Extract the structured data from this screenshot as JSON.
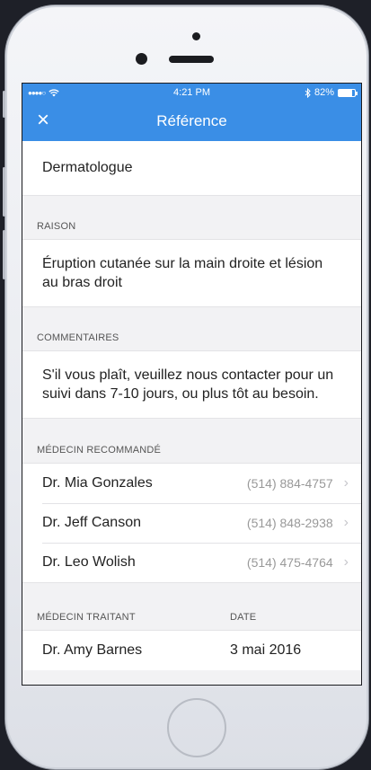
{
  "status": {
    "time": "4:21 PM",
    "battery": "82%",
    "battery_level": 0.82
  },
  "nav": {
    "title": "Référence",
    "close_icon": "close-icon"
  },
  "specialty": "Dermatologue",
  "reason": {
    "header": "RAISON",
    "text": "Éruption cutanée sur la main droite et lésion au bras droit"
  },
  "comments": {
    "header": "COMMENTAIRES",
    "text": "S'il vous plaît, veuillez nous contacter pour un suivi dans 7-10 jours, ou plus tôt au besoin."
  },
  "recommended": {
    "header": "MÉDECIN RECOMMANDÉ",
    "doctors": [
      {
        "name": "Dr. Mia Gonzales",
        "phone": "(514) 884-4757"
      },
      {
        "name": "Dr. Jeff Canson",
        "phone": "(514) 848-2938"
      },
      {
        "name": "Dr. Leo Wolish",
        "phone": "(514) 475-4764"
      }
    ]
  },
  "treating": {
    "header_doctor": "MÉDECIN TRAITANT",
    "header_date": "DATE",
    "doctor": "Dr. Amy Barnes",
    "date": "3 mai 2016"
  },
  "colors": {
    "accent": "#3a8ee6",
    "background": "#f2f2f4"
  }
}
